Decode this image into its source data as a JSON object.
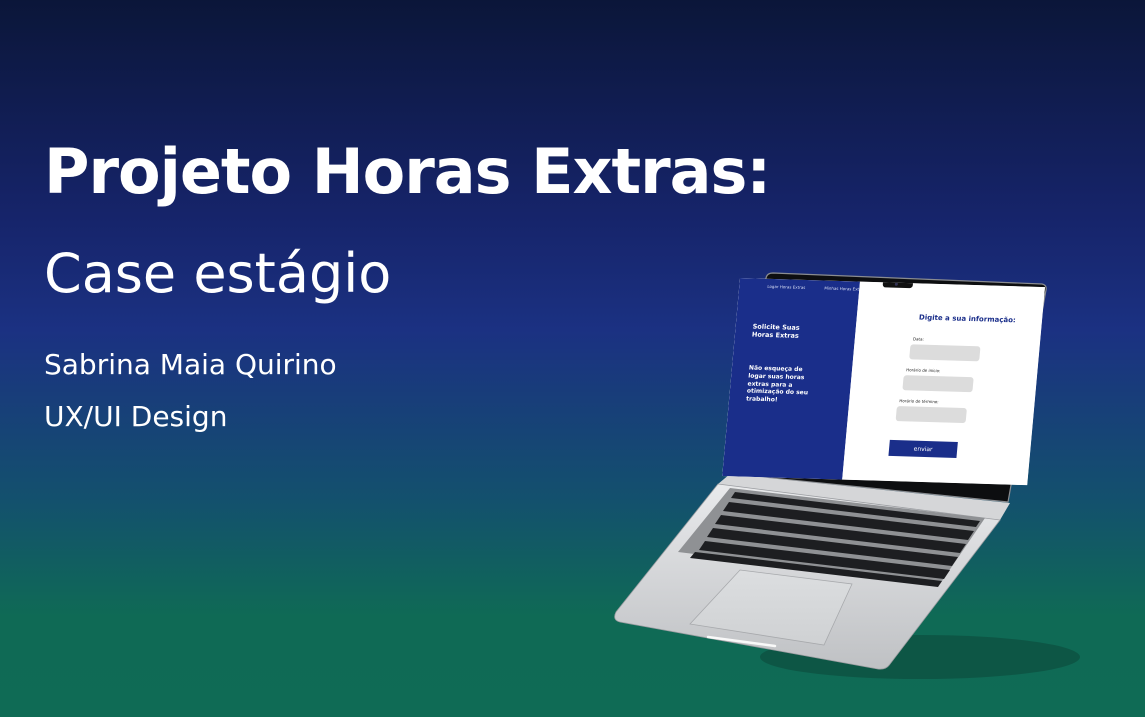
{
  "slide": {
    "title": "Projeto Horas Extras:",
    "subtitle": "Case estágio",
    "author": "Sabrina Maia Quirino",
    "role": "UX/UI Design"
  },
  "laptop_screen": {
    "nav": [
      "Logar Horas Extras",
      "Minhas Horas Extras"
    ],
    "hero_title": "Solicite Suas Horas Extras",
    "hero_text": "Não esqueça de logar suas horas extras para a otimização do seu trabalho!",
    "form_title": "Digite a sua informação:",
    "fields": [
      {
        "label": "Data:",
        "value": ""
      },
      {
        "label": "Horário de início:",
        "value": ""
      },
      {
        "label": "Horário de término:",
        "value": ""
      }
    ],
    "submit_label": "enviar"
  },
  "colors": {
    "accent": "#1a2e8a",
    "bg_top": "#0b1639",
    "bg_bottom": "#0f6b55",
    "field": "#dcdcdc"
  }
}
